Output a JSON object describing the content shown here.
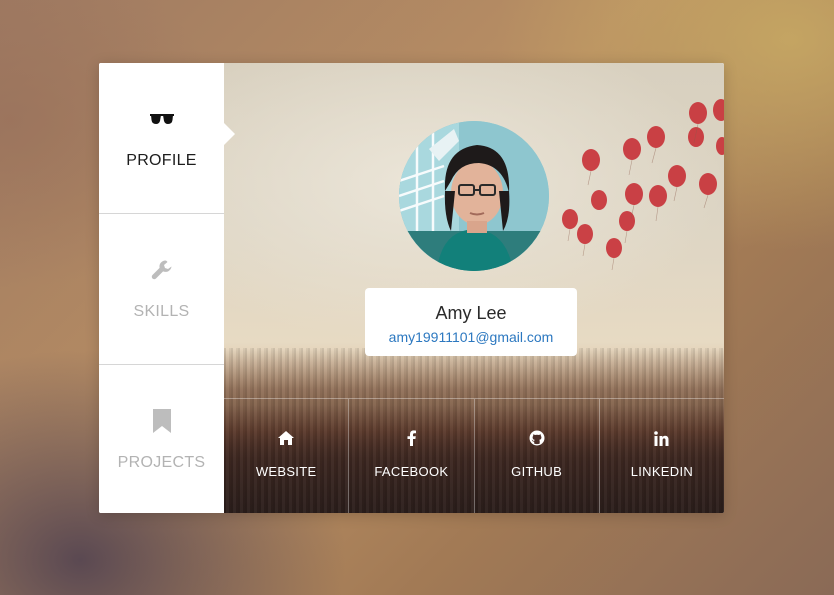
{
  "sidebar": {
    "items": [
      {
        "label": "PROFILE",
        "icon": "glasses-icon",
        "active": true
      },
      {
        "label": "SKILLS",
        "icon": "wrench-icon",
        "active": false
      },
      {
        "label": "PROJECTS",
        "icon": "bookmark-icon",
        "active": false
      }
    ]
  },
  "profile": {
    "name": "Amy Lee",
    "email": "amy19911101@gmail.com"
  },
  "social": [
    {
      "label": "WEBSITE",
      "icon": "home-icon"
    },
    {
      "label": "FACEBOOK",
      "icon": "facebook-icon"
    },
    {
      "label": "GITHUB",
      "icon": "github-icon"
    },
    {
      "label": "LINKEDIN",
      "icon": "linkedin-icon"
    }
  ],
  "colors": {
    "link": "#2c78c0",
    "balloon": "#c8343a",
    "active_text": "#1d1d1d",
    "inactive_text": "#b3b3b3"
  }
}
